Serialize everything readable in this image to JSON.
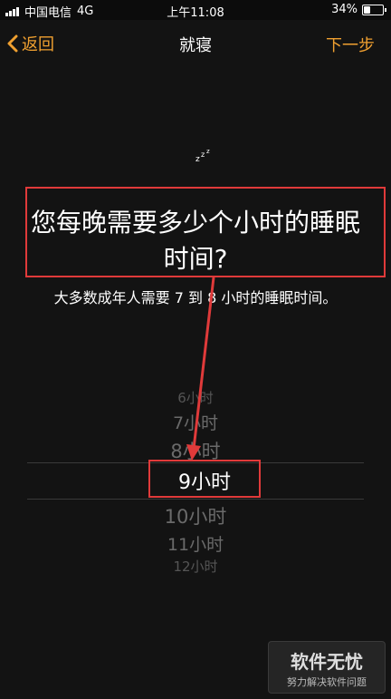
{
  "status_bar": {
    "carrier": "中国电信",
    "network": "4G",
    "time": "上午11:08",
    "battery_percent": "34%",
    "battery_level": 0.34
  },
  "nav": {
    "back_label": "返回",
    "title": "就寝",
    "next_label": "下一步",
    "accent_color": "#f0a030"
  },
  "icons": {
    "moon": "moon-zzz-icon",
    "back": "chevron-left-icon"
  },
  "question": "您每晚需要多少个小时的睡眠时间?",
  "question_lines": [
    "您每晚需要多少个小时的睡眠时间?"
  ],
  "subtitle": "大多数成年人需要 7 到 8 小时的睡眠时间。",
  "picker": {
    "items": [
      "6小时",
      "7小时",
      "8小时",
      "9小时",
      "10小时",
      "11小时",
      "12小时"
    ],
    "selected": "9小时"
  },
  "annotation_color": "#e03a3a",
  "watermark": {
    "main": "软件无忧",
    "sub": "努力解决软件问题"
  }
}
